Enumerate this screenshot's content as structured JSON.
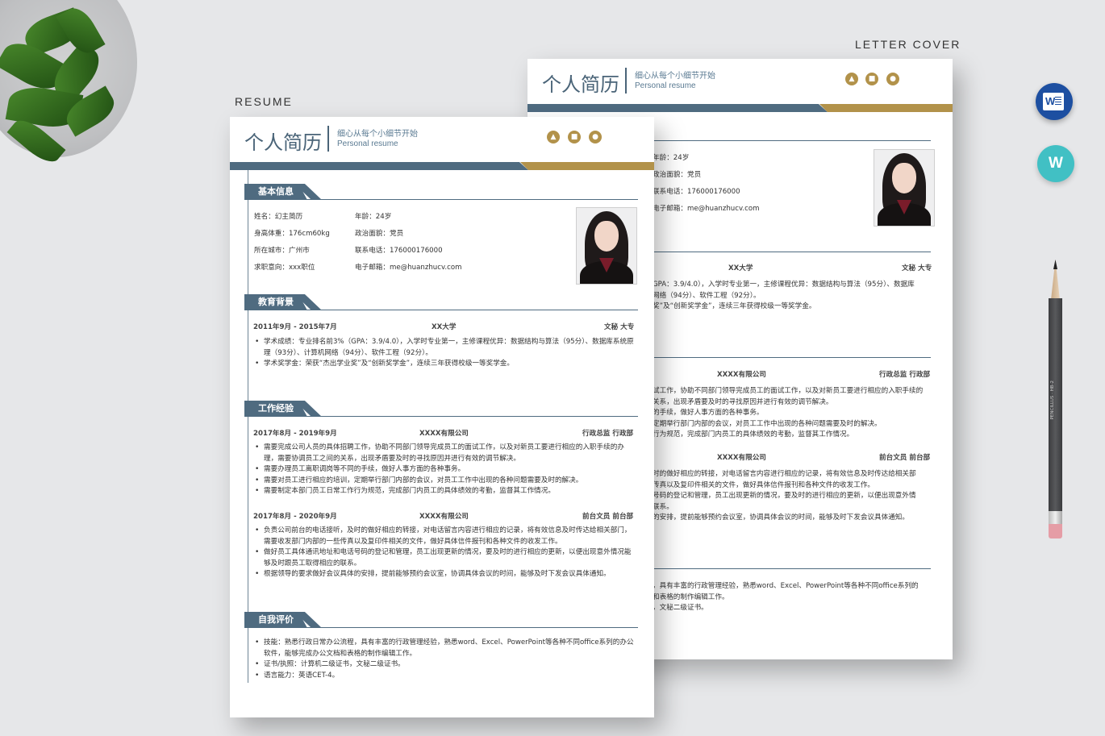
{
  "scene": {
    "resume_label": "RESUME",
    "cover_label": "LETTER COVER"
  },
  "header": {
    "title": "个人简历",
    "subtitle_cn": "细心从每个小细节开始",
    "subtitle_en": "Personal resume",
    "icons": [
      "graduation-cap-icon",
      "briefcase-icon",
      "award-icon"
    ]
  },
  "colors": {
    "accent_blue": "#4f6b80",
    "accent_gold": "#b2924a"
  },
  "sections": {
    "basic": "基本信息",
    "education": "教育背景",
    "work": "工作经验",
    "self": "自我评价"
  },
  "basic_info": {
    "name": "姓名：幻主简历",
    "age": "年龄：24岁",
    "height_weight": "身高体重：176cm60kg",
    "politics": "政治面貌：党员",
    "city": "所在城市：广州市",
    "phone": "联系电话：176000176000",
    "intention": "求职意向：xxx职位",
    "email": "电子邮箱：me@huanzhucv.com"
  },
  "education": {
    "period": "2011年9月 - 2015年7月",
    "school": "XX大学",
    "major": "文秘 大专",
    "items": [
      "学术成绩：专业排名前3%（GPA：3.9/4.0），入学时专业第一，主修课程优异：数据结构与算法（95分）、数据库系统原理（93分）、计算机网络（94分）、软件工程（92分）。",
      "学术奖学金：荣获“杰出学业奖”及“创新奖学金”，连续三年获得校级一等奖学金。"
    ]
  },
  "work": [
    {
      "period": "2017年8月 - 2019年9月",
      "company": "XXXX有限公司",
      "role": "行政总监 行政部",
      "items": [
        "需要完成公司人员的具体招聘工作，协助不同部门领导完成员工的面试工作，以及对新员工要进行相应的入职手续的办理，需要协调员工之间的关系，出现矛盾要及时的寻找原因并进行有效的调节解决。",
        "需要办理员工离职调岗等不同的手续，做好人事方面的各种事务。",
        "需要对员工进行相应的培训，定期举行部门内部的会议，对员工工作中出现的各种问题需要及时的解决。",
        "需要制定本部门员工日常工作行为规范，完成部门内员工的具体绩效的考勤，监督其工作情况。"
      ]
    },
    {
      "period": "2017年8月 - 2020年9月",
      "company": "XXXX有限公司",
      "role": "前台文员 前台部",
      "items": [
        "负责公司前台的电话接听，及时的做好相应的转接，对电话留言内容进行相应的记录，将有效信息及时传达给相关部门，需要收发部门内部的一些传真以及复印件相关的文件，做好具体信件报刊和各种文件的收发工作。",
        "做好员工具体通讯地址和电话号码的登记和管理，员工出现更新的情况，要及时的进行相应的更新，以便出现意外情况能够及时跟员工取得相应的联系。",
        "根据领导的要求做好会议具体的安排，提前能够预约会议室，协调具体会议的时间，能够及时下发会议具体通知。"
      ]
    }
  ],
  "self_eval": {
    "items": [
      "技能：熟悉行政日常办公流程，具有丰富的行政管理经验，熟悉word、Excel、PowerPoint等各种不同office系列的办公软件，能够完成办公文档和表格的制作编辑工作。",
      "证书/执照：计算机二级证书，文秘二级证书。",
      "语言能力：英语CET-4。"
    ]
  },
  "back_page": {
    "basic": [
      "年龄：24岁",
      "政治面貌：党员",
      "联系电话：176000176000",
      "电子邮箱：me@huanzhucv.com"
    ],
    "edu_items": [
      "GPA：3.9/4.0），入学时专业第一，主修课程优异：数据结构与算法（95分）、数据库",
      "网络（94分）、软件工程（92分）。",
      "奖”及“创新奖学金”，连续三年获得校级一等奖学金。"
    ],
    "work1_items": [
      "试工作，协助不同部门领导完成员工的面试工作，以及对新员工要进行相应的入职手续的",
      "关系，出现矛盾要及时的寻找原因并进行有效的调节解决。",
      "的手续，做好人事方面的各种事务。",
      "定期举行部门内部的会议，对员工工作中出现的各种问题需要及时的解决。",
      "行为规范，完成部门内员工的具体绩效的考勤，监督其工作情况。"
    ],
    "work2_items": [
      "时的做好相应的转接，对电话留言内容进行相应的记录，将有效信息及时传达给相关部",
      "传真以及复印件相关的文件，做好具体信件报刊和各种文件的收发工作。",
      "号码的登记和管理，员工出现更新的情况，要及时的进行相应的更新，以便出现意外情",
      "联系。",
      "的安排，提前能够预约会议室，协调具体会议的时间，能够及时下发会议具体通知。"
    ],
    "self_items": [
      "，具有丰富的行政管理经验，熟悉word、Excel、PowerPoint等各种不同office系列的",
      "和表格的制作编辑工作。",
      "，文秘二级证书。"
    ]
  },
  "app_icons": {
    "word_letter": "W",
    "wps_letter": "W"
  },
  "pencil": {
    "label": "PENCILLUS · HB-2"
  }
}
